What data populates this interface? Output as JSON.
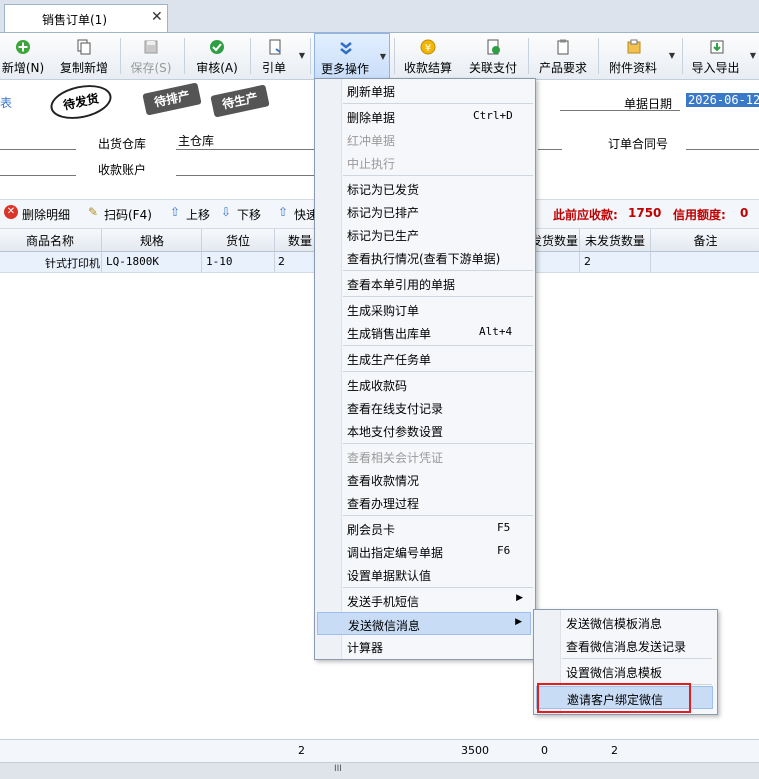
{
  "tab": {
    "title": "销售订单(1)",
    "close": "✕"
  },
  "toolbar": {
    "new": "新增(N)",
    "copy_new": "复制新增",
    "save": "保存(S)",
    "audit": "审核(A)",
    "quote": "引单",
    "more": "更多操作",
    "receive": "收款结算",
    "pay": "关联支付",
    "product_req": "产品要求",
    "attach": "附件资料",
    "import_export": "导入导出"
  },
  "header": {
    "stamps": [
      "待发货",
      "待排产",
      "待生产"
    ],
    "date_label": "单据日期",
    "date_value": "2026-06-12",
    "warehouse_label": "出货仓库",
    "warehouse_value": "主仓库",
    "contract_label": "订单合同号",
    "account_label": "收款账户",
    "left_fragment": "表"
  },
  "detail_toolbar": {
    "delete": "删除明细",
    "scan": "扫码(F4)",
    "up": "上移",
    "down": "下移",
    "quick": "快速",
    "prev_receivable_label": "此前应收款:",
    "prev_receivable_value": "1750",
    "credit_label": "信用额度:",
    "credit_value": "0"
  },
  "grid": {
    "columns": [
      "商品名称",
      "规格",
      "货位",
      "数量",
      "发货数量",
      "未发货数量",
      "备注"
    ],
    "rows": [
      {
        "name": "针式打印机",
        "spec": "LQ-1800K",
        "loc": "1-10",
        "qty": "2",
        "unshipped": "2"
      }
    ]
  },
  "footer": {
    "qty": "2",
    "amount": "3500",
    "shipped": "0",
    "unshipped": "2",
    "grip": "III"
  },
  "more_menu": [
    {
      "label": "刷新单据"
    },
    {
      "label": "删除单据",
      "key": "Ctrl+D"
    },
    {
      "label": "红冲单据",
      "disabled": true
    },
    {
      "label": "中止执行",
      "disabled": true
    },
    {
      "label": "标记为已发货"
    },
    {
      "label": "标记为已排产"
    },
    {
      "label": "标记为已生产"
    },
    {
      "label": "查看执行情况(查看下游单据)"
    },
    {
      "label": "查看本单引用的单据"
    },
    {
      "label": "生成采购订单"
    },
    {
      "label": "生成销售出库单",
      "key": "Alt+4"
    },
    {
      "label": "生成生产任务单"
    },
    {
      "label": "生成收款码"
    },
    {
      "label": "查看在线支付记录"
    },
    {
      "label": "本地支付参数设置"
    },
    {
      "label": "查看相关会计凭证",
      "disabled": true
    },
    {
      "label": "查看收款情况"
    },
    {
      "label": "查看办理过程"
    },
    {
      "label": "刷会员卡",
      "key": "F5"
    },
    {
      "label": "调出指定编号单据",
      "key": "F6"
    },
    {
      "label": "设置单据默认值"
    },
    {
      "label": "发送手机短信",
      "submenu": true
    },
    {
      "label": "发送微信消息",
      "submenu": true
    },
    {
      "label": "计算器"
    }
  ],
  "wechat_menu": [
    {
      "label": "发送微信模板消息"
    },
    {
      "label": "查看微信消息发送记录"
    },
    {
      "label": "设置微信消息模板"
    },
    {
      "label": "邀请客户绑定微信"
    }
  ],
  "colors": {
    "accent": "#3a78c8",
    "highlight_box": "#e02020",
    "red_text": "#c00000"
  }
}
